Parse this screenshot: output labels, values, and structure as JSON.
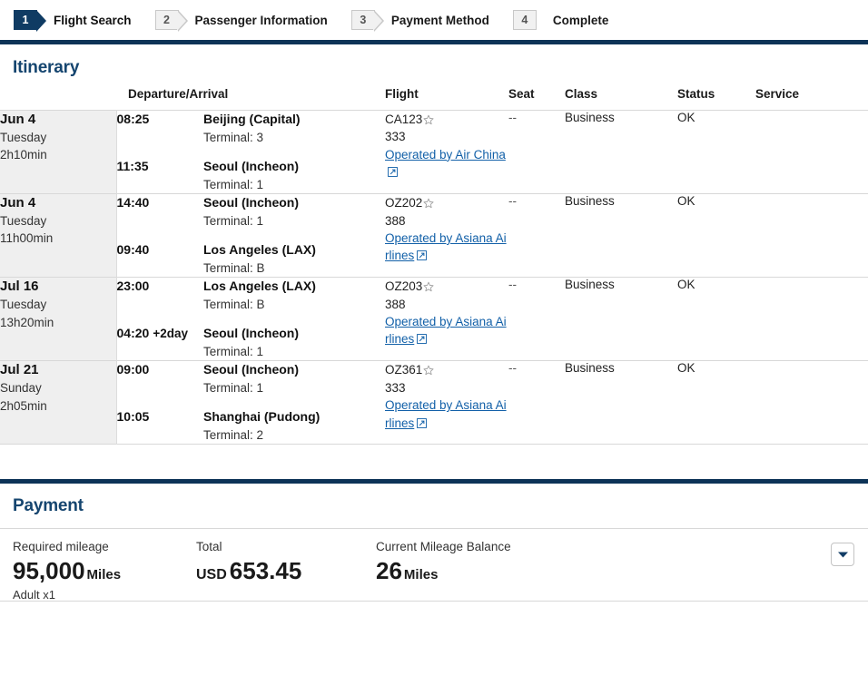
{
  "steps": [
    {
      "number": "1",
      "label": "Flight Search",
      "state": "active",
      "pointed": true
    },
    {
      "number": "2",
      "label": "Passenger Information",
      "state": "inactive",
      "pointed": true
    },
    {
      "number": "3",
      "label": "Payment Method",
      "state": "inactive",
      "pointed": true
    },
    {
      "number": "4",
      "label": "Complete",
      "state": "inactive",
      "pointed": false
    }
  ],
  "itinerary": {
    "title": "Itinerary",
    "columns": {
      "date": "",
      "departure_arrival": "Departure/Arrival",
      "flight": "Flight",
      "seat": "Seat",
      "class": "Class",
      "status": "Status",
      "service": "Service"
    },
    "rows": [
      {
        "date": "Jun 4",
        "weekday": "Tuesday",
        "duration": "2h10min",
        "depart_time": "08:25",
        "depart_dayoffset": "",
        "depart_city": "Beijing (Capital)",
        "depart_terminal": "Terminal: 3",
        "arrive_time": "11:35",
        "arrive_dayoffset": "",
        "arrive_city": "Seoul (Incheon)",
        "arrive_terminal": "Terminal: 1",
        "flight_no": "CA123",
        "aircraft": "333",
        "operated_by": "Operated by Air China",
        "seat": "--",
        "class": "Business",
        "status": "OK",
        "service": ""
      },
      {
        "date": "Jun 4",
        "weekday": "Tuesday",
        "duration": "11h00min",
        "depart_time": "14:40",
        "depart_dayoffset": "",
        "depart_city": "Seoul (Incheon)",
        "depart_terminal": "Terminal: 1",
        "arrive_time": "09:40",
        "arrive_dayoffset": "",
        "arrive_city": "Los Angeles (LAX)",
        "arrive_terminal": "Terminal: B",
        "flight_no": "OZ202",
        "aircraft": "388",
        "operated_by": "Operated by Asiana Airlines",
        "seat": "--",
        "class": "Business",
        "status": "OK",
        "service": ""
      },
      {
        "date": "Jul 16",
        "weekday": "Tuesday",
        "duration": "13h20min",
        "depart_time": "23:00",
        "depart_dayoffset": "",
        "depart_city": "Los Angeles (LAX)",
        "depart_terminal": "Terminal: B",
        "arrive_time": "04:20",
        "arrive_dayoffset": "+2day",
        "arrive_city": "Seoul (Incheon)",
        "arrive_terminal": "Terminal: 1",
        "flight_no": "OZ203",
        "aircraft": "388",
        "operated_by": "Operated by Asiana Airlines",
        "seat": "--",
        "class": "Business",
        "status": "OK",
        "service": ""
      },
      {
        "date": "Jul 21",
        "weekday": "Sunday",
        "duration": "2h05min",
        "depart_time": "09:00",
        "depart_dayoffset": "",
        "depart_city": "Seoul (Incheon)",
        "depart_terminal": "Terminal: 1",
        "arrive_time": "10:05",
        "arrive_dayoffset": "",
        "arrive_city": "Shanghai (Pudong)",
        "arrive_terminal": "Terminal: 2",
        "flight_no": "OZ361",
        "aircraft": "333",
        "operated_by": "Operated by Asiana Airlines",
        "seat": "--",
        "class": "Business",
        "status": "OK",
        "service": ""
      }
    ]
  },
  "payment": {
    "title": "Payment",
    "required_mileage_label": "Required mileage",
    "required_mileage_value": "95,000",
    "required_mileage_unit": "Miles",
    "passengers": "Adult x1",
    "total_label": "Total",
    "total_currency": "USD",
    "total_amount": "653.45",
    "balance_label": "Current Mileage Balance",
    "balance_value": "26",
    "balance_unit": "Miles"
  },
  "icons": {
    "star": "star-alliance-icon",
    "external_link": "external-link-icon",
    "chevron_down": "chevron-down-icon"
  },
  "colors": {
    "navy": "#0d3357",
    "heading": "#15456f",
    "link": "#1260a8",
    "date_bg": "#efefef"
  }
}
